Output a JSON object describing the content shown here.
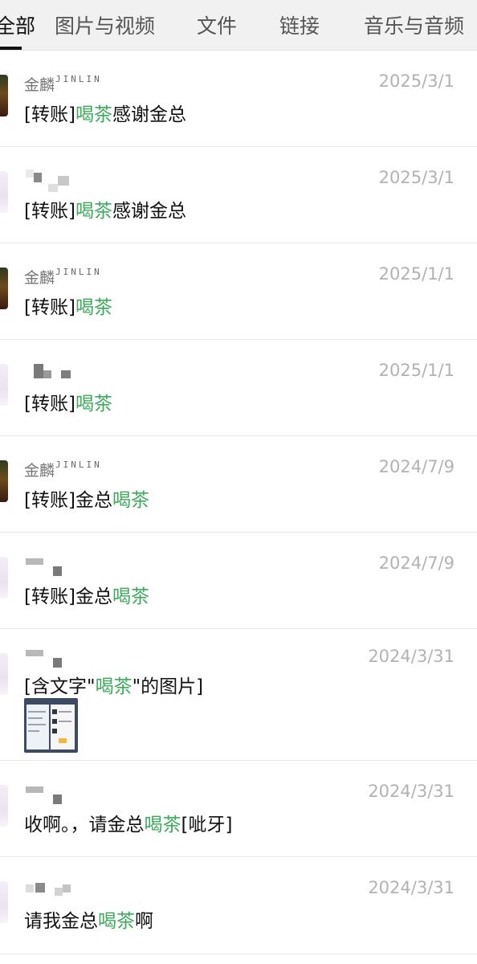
{
  "tabs": [
    {
      "label": "全部",
      "active": true
    },
    {
      "label": "图片与视频",
      "active": false
    },
    {
      "label": "文件",
      "active": false
    },
    {
      "label": "链接",
      "active": false
    },
    {
      "label": "音乐与音频",
      "active": false
    }
  ],
  "colors": {
    "highlight": "#3cab5b",
    "date": "#b2b2b2",
    "tab_bar": "#f1f1f1"
  },
  "results": [
    {
      "sender": "金麟",
      "sender_latin": "JINLIN",
      "date": "2025/3/1",
      "msg": {
        "before": "[转账]",
        "hl": "喝茶",
        "after": "感谢金总"
      }
    },
    {
      "sender": "",
      "sender_latin": "",
      "date": "2025/3/1",
      "msg": {
        "before": "[转账]",
        "hl": "喝茶",
        "after": "感谢金总"
      }
    },
    {
      "sender": "金麟",
      "sender_latin": "JINLIN",
      "date": "2025/1/1",
      "msg": {
        "before": "[转账]",
        "hl": "喝茶",
        "after": ""
      }
    },
    {
      "sender": "",
      "sender_latin": "",
      "date": "2025/1/1",
      "msg": {
        "before": "[转账]",
        "hl": "喝茶",
        "after": ""
      }
    },
    {
      "sender": "金麟",
      "sender_latin": "JINLIN",
      "date": "2024/7/9",
      "msg": {
        "before": "[转账]金总",
        "hl": "喝茶",
        "after": ""
      }
    },
    {
      "sender": "",
      "sender_latin": "",
      "date": "2024/7/9",
      "msg": {
        "before": "[转账]金总",
        "hl": "喝茶",
        "after": ""
      }
    },
    {
      "sender": "",
      "sender_latin": "",
      "date": "2024/3/31",
      "msg": {
        "before": "[含文字\"",
        "hl": "喝茶",
        "after": "\"的图片]"
      }
    },
    {
      "sender": "",
      "sender_latin": "",
      "date": "2024/3/31",
      "msg": {
        "before": "收啊。，请金总",
        "hl": "喝茶",
        "after": "[呲牙]"
      }
    },
    {
      "sender": "",
      "sender_latin": "",
      "date": "2024/3/31",
      "msg": {
        "before": "请我金总",
        "hl": "喝茶",
        "after": "啊"
      }
    }
  ]
}
